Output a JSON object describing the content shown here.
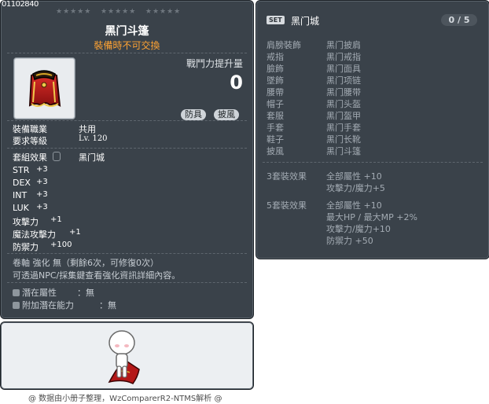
{
  "item": {
    "id": "01102840",
    "stars_rows": [
      "★★★★★",
      "★★★★★",
      "★★★★★"
    ],
    "name": "黑门斗篷",
    "trade_note": "裝備時不可交換",
    "cp_label": "戰鬥力提升量",
    "cp_value": "0",
    "tags": [
      "防具",
      "披風"
    ],
    "job_label": "裝備職業",
    "job_value": "共用",
    "level_label": "要求等級",
    "level_value": "Lv. 120",
    "set_label": "套組效果",
    "set_value": "黑门城",
    "stats": [
      {
        "k": "STR",
        "v": "+3"
      },
      {
        "k": "DEX",
        "v": "+3"
      },
      {
        "k": "INT",
        "v": "+3"
      },
      {
        "k": "LUK",
        "v": "+3"
      },
      {
        "k": "攻擊力",
        "v": "+1"
      },
      {
        "k": "魔法攻擊力",
        "v": "+1"
      },
      {
        "k": "防禦力",
        "v": "+100"
      }
    ],
    "scroll_line": "卷軸 強化 無（剩餘6次，可修復0次）",
    "npc_line": "可透過NPC/採集鍵查看強化資訊詳細內容。",
    "potential_label": "潛在屬性",
    "potential_value": "：無",
    "bonus_label": "附加潛在能力",
    "bonus_value": "：無"
  },
  "set": {
    "badge": "SET",
    "name": "黑门城",
    "count": "0 / 5",
    "parts": [
      {
        "slot": "肩膀裝飾",
        "name": "黑门披肩"
      },
      {
        "slot": "戒指",
        "name": "黑门戒指"
      },
      {
        "slot": "臉飾",
        "name": "黑门面具"
      },
      {
        "slot": "墜飾",
        "name": "黑门项链"
      },
      {
        "slot": "腰帶",
        "name": "黑门腰带"
      },
      {
        "slot": "帽子",
        "name": "黑门头盔"
      },
      {
        "slot": "套服",
        "name": "黑门盔甲"
      },
      {
        "slot": "手套",
        "name": "黑门手套"
      },
      {
        "slot": "鞋子",
        "name": "黑门长靴"
      },
      {
        "slot": "披風",
        "name": "黑门斗篷"
      }
    ],
    "effects": [
      {
        "label": "3套裝效果",
        "lines": [
          "全部屬性 +10",
          "攻擊力/魔力+5"
        ]
      },
      {
        "label": "5套裝效果",
        "lines": [
          "全部屬性 +10",
          "最大HP / 最大MP  +2%",
          "攻擊力/魔力+10",
          "防禦力  +50"
        ]
      }
    ]
  },
  "footer": "@ 数据由小册子整理，WzComparerR2-NTMS解析 @",
  "colors": {
    "panel": "#3a424a",
    "accent_orange": "#ffa333",
    "preview_bg": "#eceff2"
  }
}
